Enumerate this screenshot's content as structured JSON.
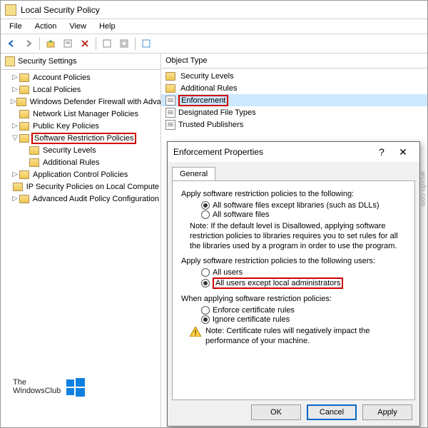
{
  "window": {
    "title": "Local Security Policy"
  },
  "menu": {
    "file": "File",
    "action": "Action",
    "view": "View",
    "help": "Help"
  },
  "tree": {
    "header": "Security Settings",
    "items": [
      {
        "label": "Account Policies",
        "indent": 1,
        "exp": "▷"
      },
      {
        "label": "Local Policies",
        "indent": 1,
        "exp": "▷"
      },
      {
        "label": "Windows Defender Firewall with Adva",
        "indent": 1,
        "exp": "▷"
      },
      {
        "label": "Network List Manager Policies",
        "indent": 1,
        "exp": ""
      },
      {
        "label": "Public Key Policies",
        "indent": 1,
        "exp": "▷"
      },
      {
        "label": "Software Restriction Policies",
        "indent": 1,
        "exp": "▽",
        "hl": true
      },
      {
        "label": "Security Levels",
        "indent": 2,
        "exp": ""
      },
      {
        "label": "Additional Rules",
        "indent": 2,
        "exp": ""
      },
      {
        "label": "Application Control Policies",
        "indent": 1,
        "exp": "▷"
      },
      {
        "label": "IP Security Policies on Local Compute",
        "indent": 1,
        "exp": ""
      },
      {
        "label": "Advanced Audit Policy Configuration",
        "indent": 1,
        "exp": "▷"
      }
    ]
  },
  "list": {
    "header": "Object Type",
    "items": [
      {
        "label": "Security Levels",
        "icon": "folder"
      },
      {
        "label": "Additional Rules",
        "icon": "folder"
      },
      {
        "label": "Enforcement",
        "icon": "doc",
        "selected": true,
        "hl": true
      },
      {
        "label": "Designated File Types",
        "icon": "doc"
      },
      {
        "label": "Trusted Publishers",
        "icon": "doc"
      }
    ]
  },
  "dialog": {
    "title": "Enforcement Properties",
    "tab": "General",
    "g1": "Apply software restriction policies to the following:",
    "r1a": "All software files except libraries (such as DLLs)",
    "r1b": "All software files",
    "note1": "Note:   If the default level is Disallowed, applying software restriction policies to libraries requires you to set rules for all the libraries used by a program in order to use the program.",
    "g2": "Apply software restriction policies to the following users:",
    "r2a": "All users",
    "r2b": "All users except local administrators",
    "g3": "When applying software restriction policies:",
    "r3a": "Enforce certificate rules",
    "r3b": "Ignore certificate rules",
    "note2": "Note:  Certificate rules will negatively impact the performance of your machine.",
    "ok": "OK",
    "cancel": "Cancel",
    "apply": "Apply"
  },
  "watermark": {
    "line1": "The",
    "line2": "WindowsClub"
  },
  "side": "wsxdn.com"
}
